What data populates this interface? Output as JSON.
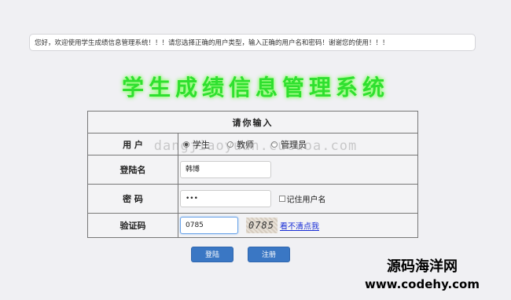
{
  "welcome_message": "您好，欢迎使用学生成绩信息管理系统！！！请您选择正确的用户类型，输入正确的用户名和密码！谢谢您的使用！！！",
  "title": "学生成绩信息管理系统",
  "form": {
    "header": "请你输入",
    "user_type_label": "用  户",
    "user_types": [
      "学生",
      "教师",
      "管理员"
    ],
    "selected_user_type": "学生",
    "username_label": "登陆名",
    "username_value": "韩博",
    "password_label": "密  码",
    "password_value": "•••",
    "remember_label": "记住用户名",
    "captcha_label": "验证码",
    "captcha_value": "0785",
    "captcha_image_text": "0785",
    "captcha_refresh": "看不清点我"
  },
  "buttons": {
    "login": "登陆",
    "register": "注册"
  },
  "watermark": "dangjiaoyuan.cucuoa.com",
  "branding": {
    "line1": "源码海洋网",
    "line2": "www.codehy.com"
  }
}
